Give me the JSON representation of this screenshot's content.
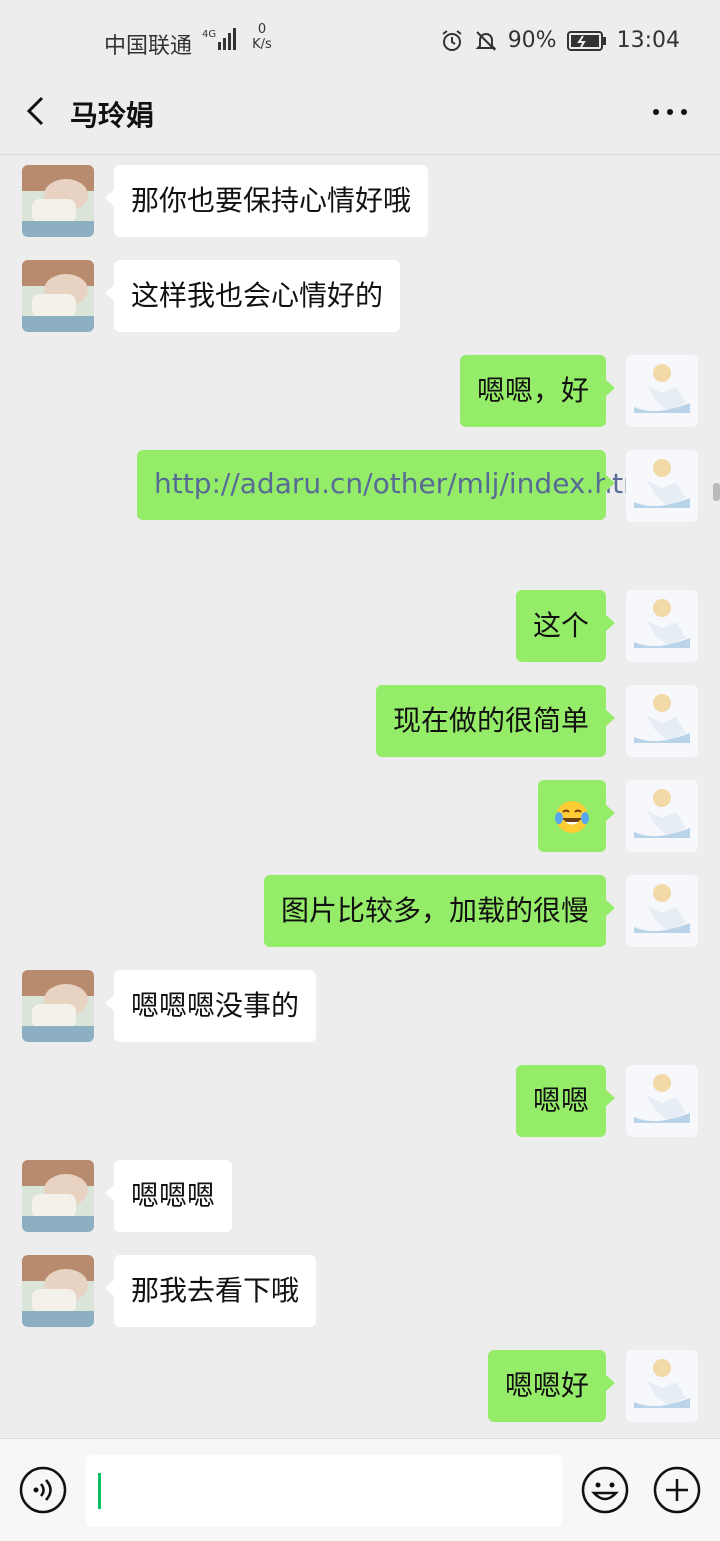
{
  "status_bar": {
    "carrier": "中国联通",
    "network": "4G",
    "speed_value": "0",
    "speed_unit": "K/s",
    "battery": "90%",
    "time": "13:04"
  },
  "header": {
    "title": "马玲娟"
  },
  "messages": [
    {
      "side": "in",
      "text": "那你也要保持心情好哦"
    },
    {
      "side": "in",
      "text": "这样我也会心情好的"
    },
    {
      "side": "out",
      "text": "嗯嗯，好"
    },
    {
      "side": "out",
      "text": "http://adaru.cn/other/mlj/index.html",
      "type": "link"
    },
    {
      "side": "out",
      "text": "这个"
    },
    {
      "side": "out",
      "text": "现在做的很简单"
    },
    {
      "side": "out",
      "text": "",
      "type": "emoji",
      "emoji": "tears-of-joy-emoji"
    },
    {
      "side": "out",
      "text": "图片比较多，加载的很慢"
    },
    {
      "side": "in",
      "text": "嗯嗯嗯没事的"
    },
    {
      "side": "out",
      "text": "嗯嗯"
    },
    {
      "side": "in",
      "text": "嗯嗯嗯"
    },
    {
      "side": "in",
      "text": "那我去看下哦"
    },
    {
      "side": "out",
      "text": "嗯嗯好"
    }
  ],
  "input_bar": {
    "input_value": "",
    "icons": [
      "voice-icon",
      "emoji-icon",
      "plus-icon"
    ]
  },
  "colors": {
    "background": "#ededed",
    "outgoing_bubble": "#95ec69",
    "incoming_bubble": "#ffffff",
    "link": "#576b95",
    "cursor": "#07c160"
  }
}
